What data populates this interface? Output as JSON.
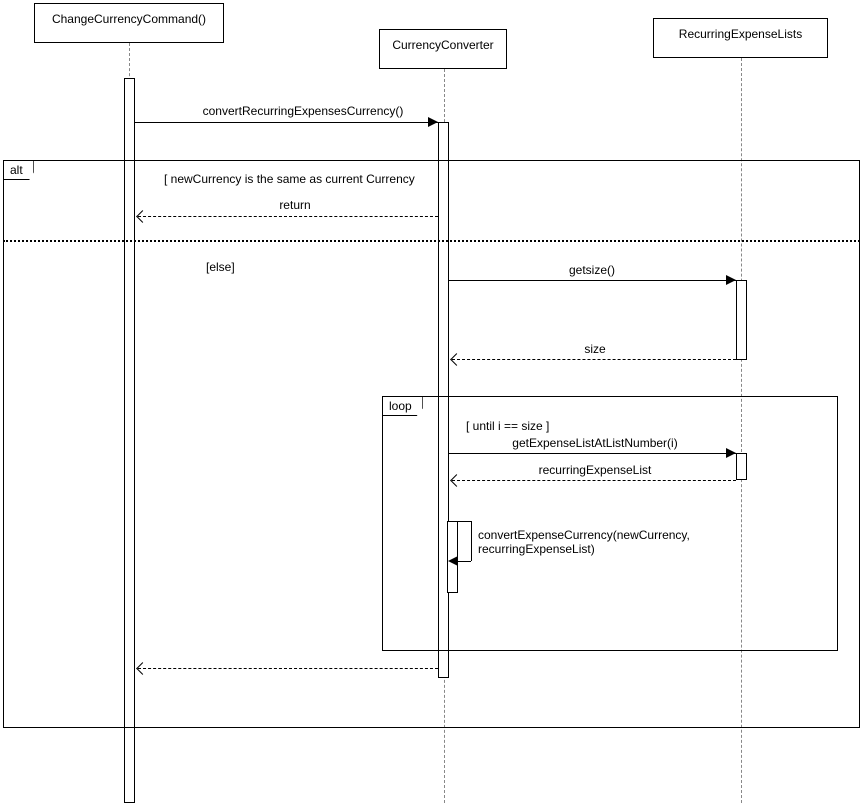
{
  "participants": {
    "p1": "ChangeCurrencyCommand()",
    "p2": "CurrencyConverter",
    "p3": "RecurringExpenseLists"
  },
  "messages": {
    "m1": "convertRecurringExpensesCurrency()",
    "m2": "return",
    "m3": "getsize()",
    "m4": "size",
    "m5": "getExpenseListAtListNumber(i)",
    "m6": "recurringExpenseList",
    "m7": "convertExpenseCurrency(newCurrency, recurringExpenseList)"
  },
  "fragments": {
    "alt_label": "alt",
    "alt_guard1": "[ newCurrency is the same as current Currency",
    "alt_guard2": "[else]",
    "loop_label": "loop",
    "loop_guard": "[ until i == size ]"
  }
}
